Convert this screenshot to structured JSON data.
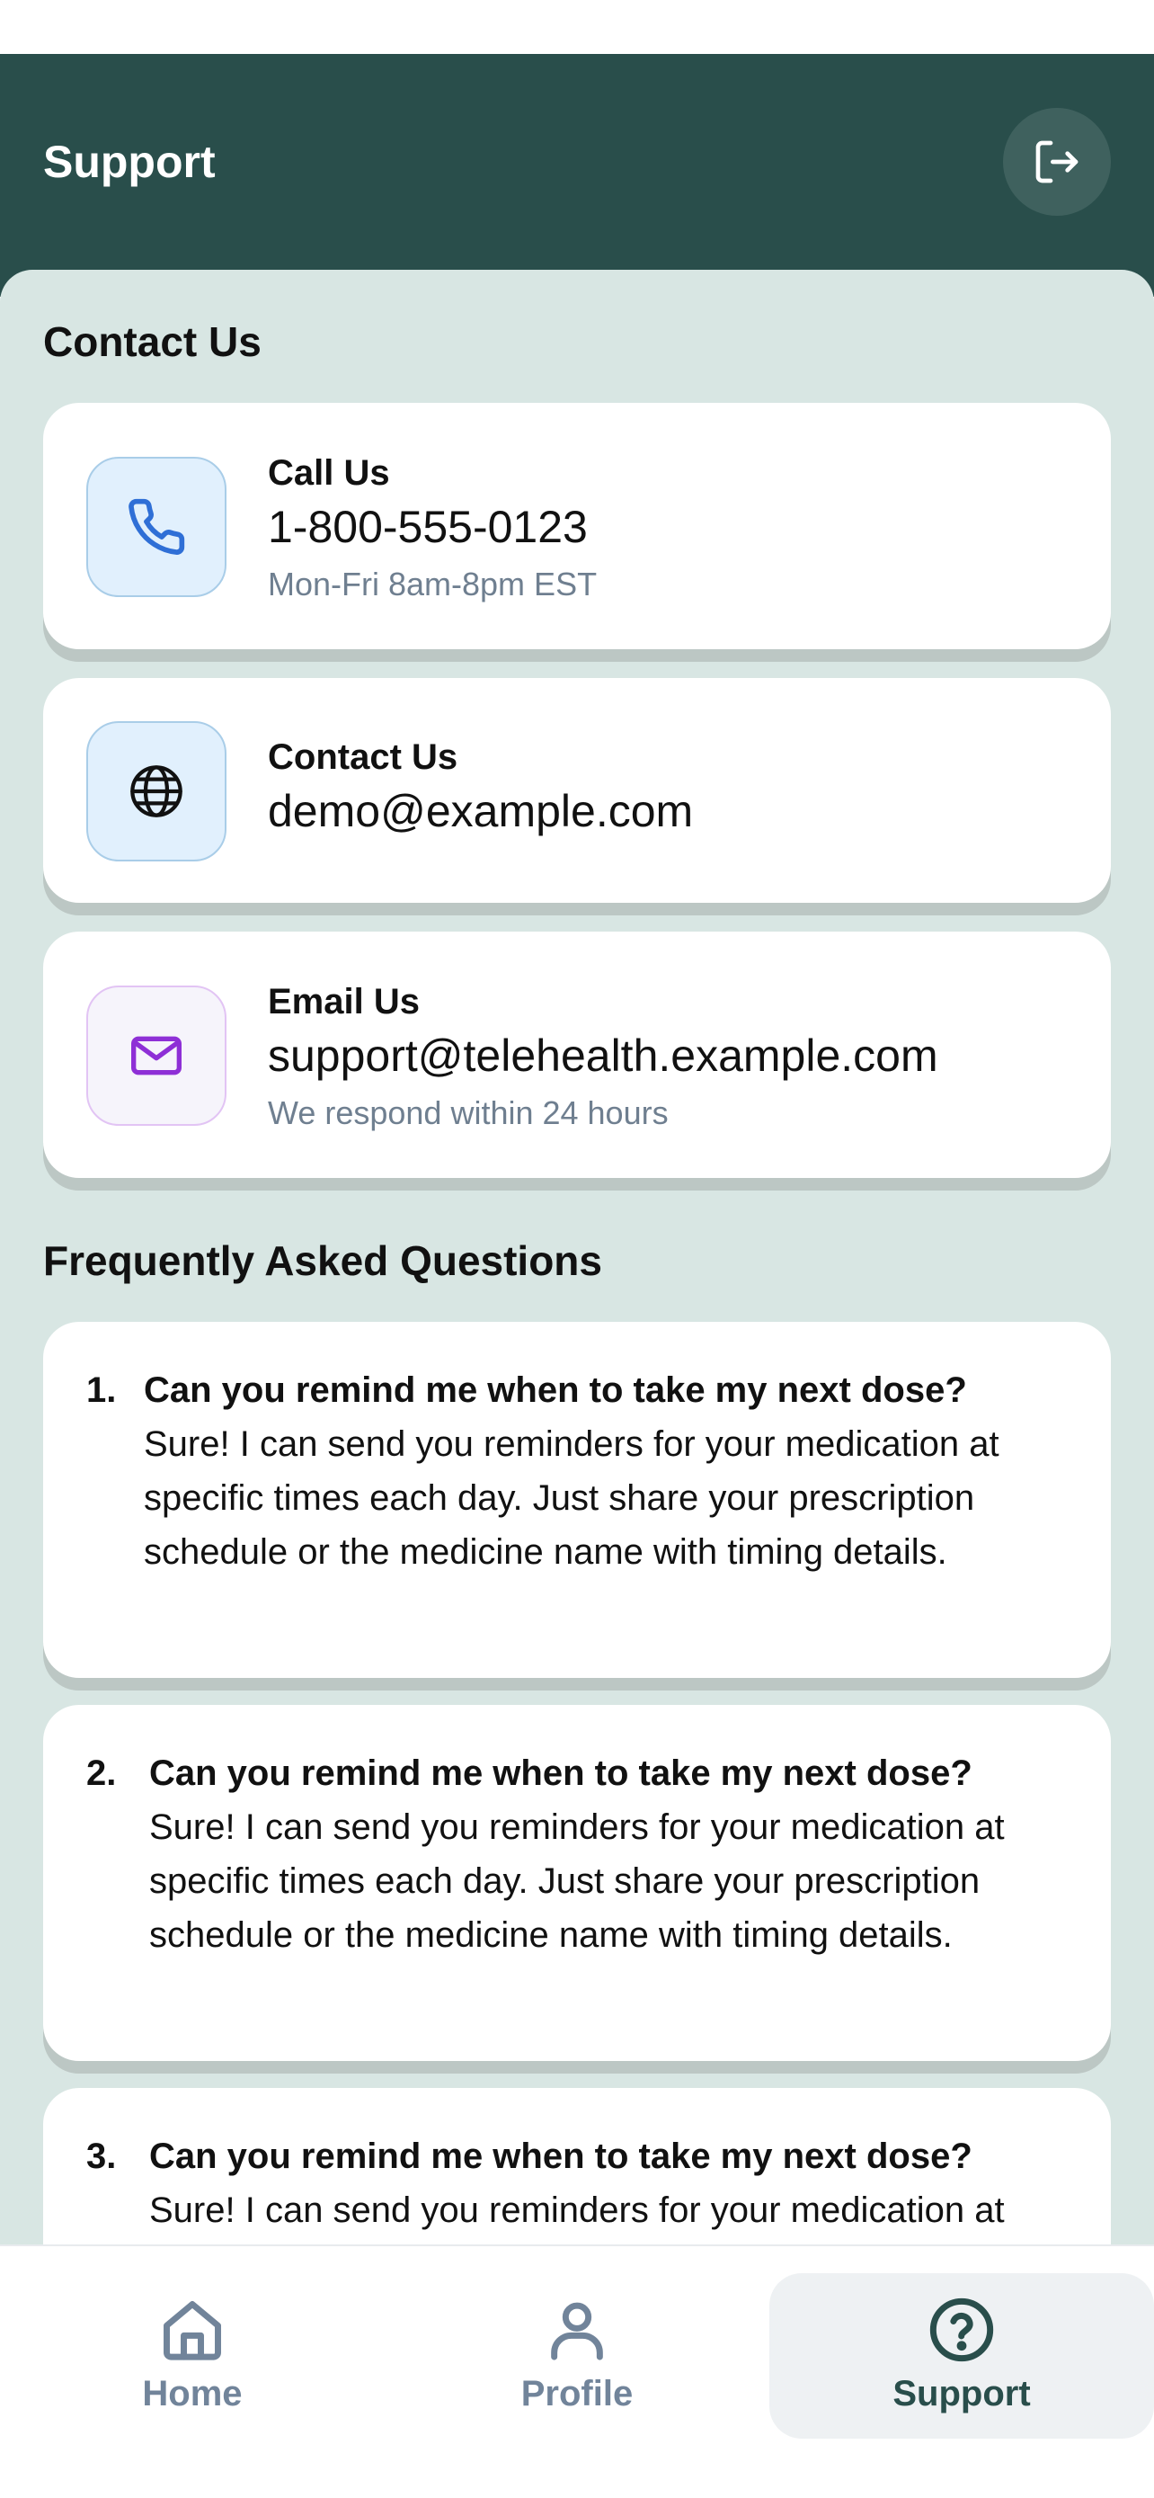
{
  "header": {
    "title": "Support",
    "logout_icon": "logout-icon"
  },
  "contact_section": {
    "title": "Contact Us",
    "cards": [
      {
        "icon": "phone-icon",
        "label": "Call Us",
        "value": "1-800-555-0123",
        "sub": "Mon-Fri 8am-8pm EST"
      },
      {
        "icon": "globe-icon",
        "label": "Contact Us",
        "value": "demo@example.com"
      },
      {
        "icon": "mail-icon",
        "label": "Email Us",
        "value": "support@telehealth.example.com",
        "sub": "We respond within 24 hours"
      }
    ]
  },
  "faq_section": {
    "title": "Frequently Asked Questions",
    "items": [
      {
        "number": "1.",
        "question": "Can you remind me when to take my next dose?",
        "answer": "Sure! I can send you reminders for your medication at specific times each day. Just share your prescription schedule or the medicine name with timing details."
      },
      {
        "number": "2.",
        "question": "Can you remind me when to take my next dose?",
        "answer": "Sure! I can send you reminders for your medication at specific times each day. Just share your prescription schedule or the medicine name with timing details."
      },
      {
        "number": "3.",
        "question": "Can you remind me when to take my next dose?",
        "answer": "Sure! I can send you reminders for your medication at specific times each day. Just share your prescription schedule or the medicine name with timing details."
      }
    ]
  },
  "bottom_nav": {
    "items": [
      {
        "label": "Home",
        "icon": "home-icon",
        "active": false
      },
      {
        "label": "Profile",
        "icon": "user-icon",
        "active": false
      },
      {
        "label": "Support",
        "icon": "help-circle-icon",
        "active": true
      }
    ]
  },
  "colors": {
    "header_bg": "#294e4b",
    "content_bg": "#d8e6e3",
    "inactive_nav": "#71849a",
    "active_nav": "#294e4b",
    "phone_icon": "#2f6fd6",
    "mail_icon": "#8e2fd6"
  }
}
